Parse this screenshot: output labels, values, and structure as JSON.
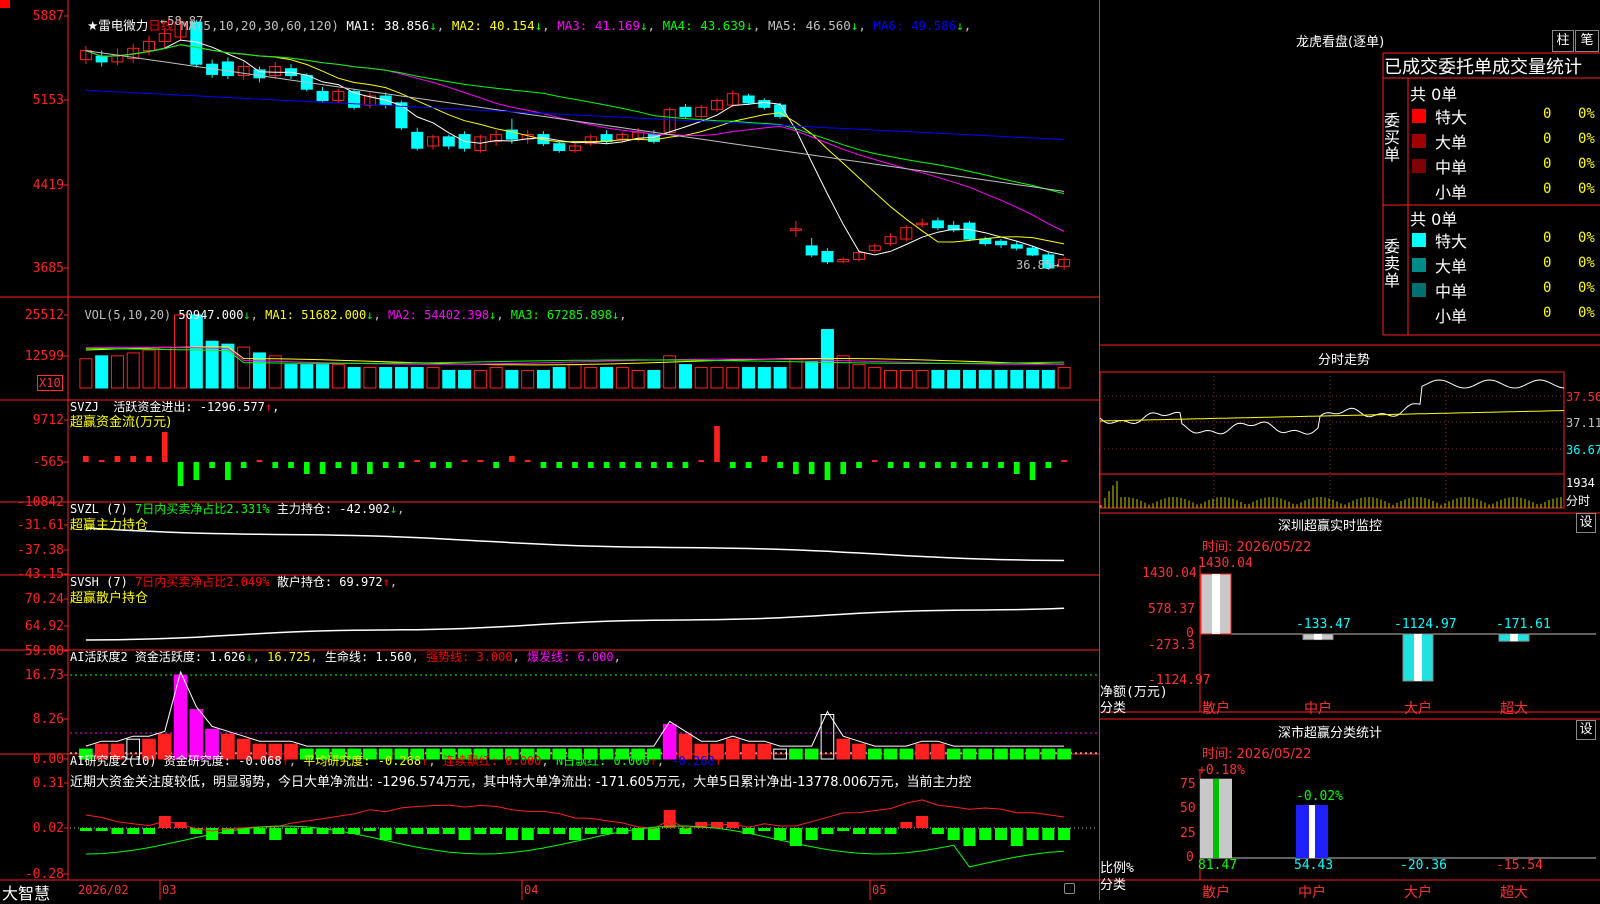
{
  "stock": {
    "name": "雷电微力",
    "period": "日线",
    "ma_params": "MA(5,10,20,30,60,120)"
  },
  "price_panel": {
    "y_ticks": [
      "5887",
      "5153",
      "4419",
      "3685"
    ],
    "ma_items": [
      {
        "label": "MA1: 38.856",
        "color": "#ffffff"
      },
      {
        "label": "MA2: 40.154",
        "color": "#ffff00"
      },
      {
        "label": "MA3: 41.169",
        "color": "#ff00ff"
      },
      {
        "label": "MA4: 43.639",
        "color": "#00ff00"
      },
      {
        "label": "MA5: 46.560",
        "color": "#c0c0c0"
      },
      {
        "label": "MA6: 49.586",
        "color": "#0000ff"
      }
    ],
    "high_label": "58.87",
    "low_label": "36.85"
  },
  "vol_panel": {
    "header": "VOL(5,10,20)",
    "value": "50947.000",
    "ma_items": [
      {
        "label": "MA1: 51682.000",
        "color": "#ffff00"
      },
      {
        "label": "MA2: 54402.398",
        "color": "#ff00ff"
      },
      {
        "label": "MA3: 67285.898",
        "color": "#00ff00"
      }
    ],
    "y_ticks": [
      "25512",
      "12599"
    ],
    "unit": "X10"
  },
  "svzj_panel": {
    "header": "SVZJ  活跃资金进出: -1296.577",
    "subtitle": "超赢资金流(万元)",
    "y_ticks": [
      "9712",
      "-565",
      "-10842"
    ]
  },
  "svzl_panel": {
    "header_a": "SVZL (7)",
    "header_b": "7日内买卖净占比2.331%",
    "header_c": "主力持仓: -42.902",
    "subtitle": "超赢主力持仓",
    "y_ticks": [
      "-31.61",
      "-37.38",
      "-43.15"
    ]
  },
  "svsh_panel": {
    "header_a": "SVSH (7)",
    "header_b": "7日内买卖净占比2.049%",
    "header_c": "散户持仓: 69.972",
    "subtitle": "超赢散户持仓",
    "y_ticks": [
      "70.24",
      "64.92",
      "59.80"
    ]
  },
  "ai_active_panel": {
    "header_a": "AI活跃度2 资金活跃度: 1.626",
    "header_b": "16.725",
    "header_c": "生命线: 1.560",
    "header_d": "强势线: 3.000",
    "header_e": "爆发线: 6.000",
    "y_ticks": [
      "16.73",
      "8.26",
      "0.00"
    ]
  },
  "ai_research_panel": {
    "header_a": "AI研究度2(10) 资金研究度: -0.068",
    "header_b": "平均研究度: -0.268",
    "header_c": "连续飘红: 0.000",
    "header_d": "N日飘红: 0.000",
    "header_e": "-0.268",
    "comment": "近期大资金关注度较低，明显弱势，今日大单净流出: -1296.574万元，其中特大单净流出: -171.605万元，大单5日累计净出-13778.006万元，当前主力控",
    "y_ticks": [
      "0.31",
      "0.02",
      "-0.28"
    ]
  },
  "date_axis": {
    "labels": [
      "2026/02",
      "03",
      "04",
      "05"
    ],
    "brand": "大智慧"
  },
  "dragon_tiger": {
    "title": "龙虎看盘(逐单)",
    "btn_bar": "柱",
    "btn_tick": "笔",
    "header": "已成交委托单成交量统计",
    "buy_total": "共 0单",
    "buy_label": "委买单",
    "sell_total": "共 0单",
    "sell_label": "委卖单",
    "buy_rows": [
      {
        "label": "特大",
        "count": "0",
        "pct": "0%",
        "color": "#ff0000"
      },
      {
        "label": "大单",
        "count": "0",
        "pct": "0%",
        "color": "#a00000"
      },
      {
        "label": "中单",
        "count": "0",
        "pct": "0%",
        "color": "#800000"
      },
      {
        "label": "小单",
        "count": "0",
        "pct": "0%",
        "color": ""
      }
    ],
    "sell_rows": [
      {
        "label": "特大",
        "count": "0",
        "pct": "0%",
        "color": "#00ffff"
      },
      {
        "label": "大单",
        "count": "0",
        "pct": "0%",
        "color": "#008b8b"
      },
      {
        "label": "中单",
        "count": "0",
        "pct": "0%",
        "color": "#007070"
      },
      {
        "label": "小单",
        "count": "0",
        "pct": "0%",
        "color": ""
      }
    ]
  },
  "intraday": {
    "title": "分时走势",
    "y_ticks": [
      "37.56",
      "37.11",
      "36.67"
    ],
    "vol_tick": "1934",
    "vol_unit": "分时"
  },
  "sz_monitor": {
    "title": "深圳超赢实时监控",
    "set": "设",
    "time": "时间: 2026/05/22",
    "y_ticks": [
      "1430.04",
      "578.37",
      "0",
      "-273.3",
      "-1124.97"
    ],
    "ylabel": "净额(万元)",
    "xlabel": "分类",
    "categories": [
      "散户",
      "中户",
      "大户",
      "超大"
    ],
    "values": [
      1430.04,
      -133.47,
      -1124.97,
      -171.61
    ],
    "value_labels": [
      "1430.04",
      "-133.47",
      "-1124.97",
      "-171.61"
    ]
  },
  "sz_category": {
    "title": "深市超赢分类统计",
    "set": "设",
    "time": "时间: 2026/05/22",
    "y_ticks": [
      "75",
      "50",
      "25",
      "0"
    ],
    "ylabel": "比例%",
    "xlabel": "分类",
    "categories": [
      "散户",
      "中户",
      "大户",
      "超大"
    ],
    "ratios": [
      "81.47",
      "54.43",
      "-20.36",
      "-15.54"
    ],
    "top_labels": [
      "+0.18%",
      "-0.02%"
    ]
  },
  "chart_data": [
    {
      "type": "candlestick",
      "title": "雷电微力 日线",
      "ylim": [
        36.85,
        58.87
      ],
      "x": [
        "2026/02",
        "03",
        "04",
        "05"
      ],
      "series": [
        {
          "name": "MA1",
          "value": 38.856
        },
        {
          "name": "MA2",
          "value": 40.154
        },
        {
          "name": "MA3",
          "value": 41.169
        },
        {
          "name": "MA4",
          "value": 43.639
        },
        {
          "name": "MA5",
          "value": 46.56
        },
        {
          "name": "MA6",
          "value": 49.586
        }
      ],
      "annotations": [
        "58.87",
        "36.85"
      ]
    },
    {
      "type": "bar",
      "title": "深圳超赢实时监控",
      "categories": [
        "散户",
        "中户",
        "大户",
        "超大"
      ],
      "values": [
        1430.04,
        -133.47,
        -1124.97,
        -171.61
      ],
      "ylabel": "净额(万元)",
      "ylim": [
        -1124.97,
        1430.04
      ]
    },
    {
      "type": "bar",
      "title": "深市超赢分类统计",
      "categories": [
        "散户",
        "中户",
        "大户",
        "超大"
      ],
      "values": [
        81.47,
        54.43,
        -20.36,
        -15.54
      ],
      "ylabel": "比例%",
      "ylim": [
        0,
        75
      ]
    }
  ]
}
